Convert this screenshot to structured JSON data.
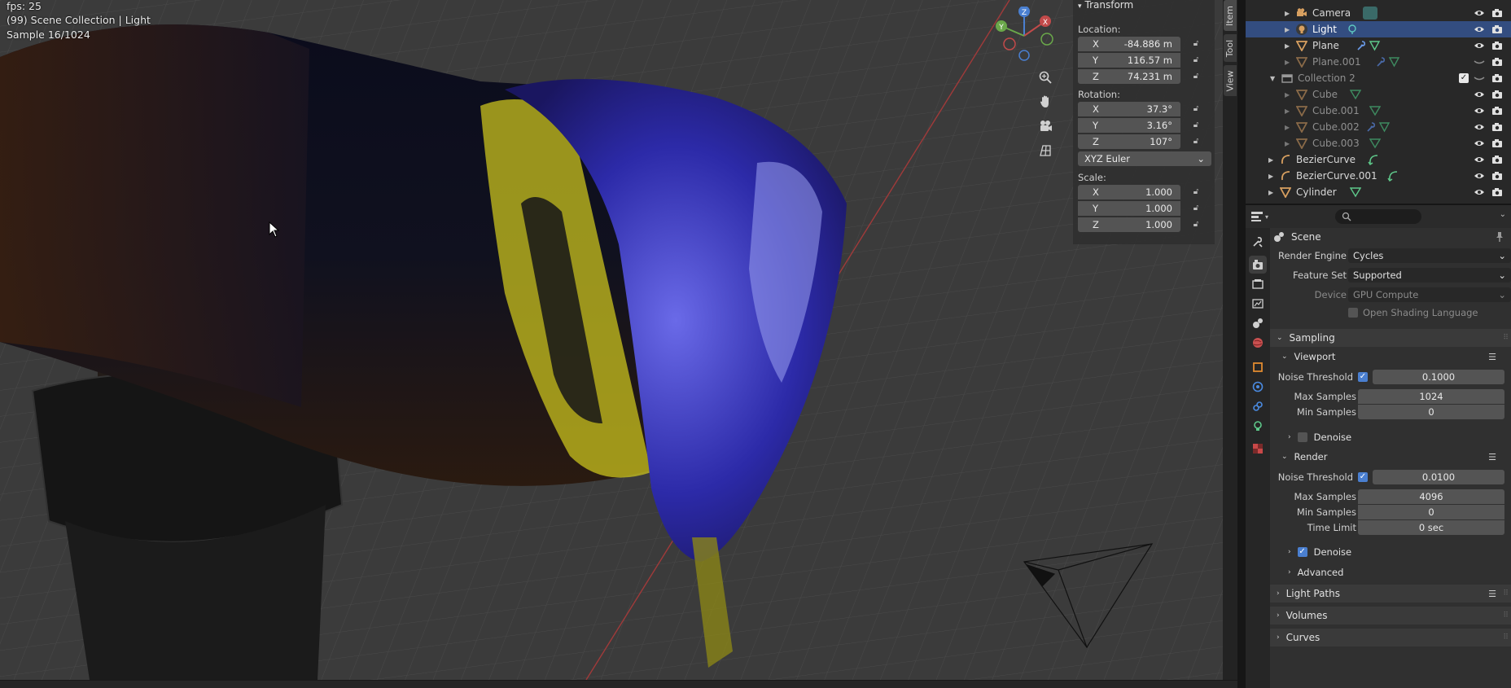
{
  "viewport": {
    "fps": "fps: 25",
    "collection": "(99) Scene Collection | Light",
    "sample": "Sample 16/1024",
    "gizmo": {
      "z": "Z",
      "y": "Y",
      "x": "X"
    }
  },
  "npanel": {
    "header": "Transform",
    "location_label": "Location:",
    "location": [
      {
        "axis": "X",
        "value": "-84.886 m"
      },
      {
        "axis": "Y",
        "value": "116.57 m"
      },
      {
        "axis": "Z",
        "value": "74.231 m"
      }
    ],
    "rotation_label": "Rotation:",
    "rotation": [
      {
        "axis": "X",
        "value": "37.3°"
      },
      {
        "axis": "Y",
        "value": "3.16°"
      },
      {
        "axis": "Z",
        "value": "107°"
      }
    ],
    "rotation_mode": "XYZ Euler",
    "scale_label": "Scale:",
    "scale": [
      {
        "axis": "X",
        "value": "1.000"
      },
      {
        "axis": "Y",
        "value": "1.000"
      },
      {
        "axis": "Z",
        "value": "1.000"
      }
    ]
  },
  "vtabs": [
    "Item",
    "Tool",
    "View"
  ],
  "outliner": {
    "items": [
      {
        "name": "Camera",
        "icon": "camera-icon"
      },
      {
        "name": "Light",
        "icon": "light-icon",
        "selected": true
      },
      {
        "name": "Plane",
        "icon": "mesh-icon"
      },
      {
        "name": "Plane.001",
        "icon": "mesh-icon",
        "dim": true
      },
      {
        "name": "Collection 2",
        "icon": "collection-icon",
        "dim": true
      },
      {
        "name": "Cube",
        "icon": "mesh-icon",
        "dim": true
      },
      {
        "name": "Cube.001",
        "icon": "mesh-icon",
        "dim": true
      },
      {
        "name": "Cube.002",
        "icon": "mesh-icon",
        "dim": true
      },
      {
        "name": "Cube.003",
        "icon": "mesh-icon",
        "dim": true
      },
      {
        "name": "BezierCurve",
        "icon": "curve-icon"
      },
      {
        "name": "BezierCurve.001",
        "icon": "curve-icon"
      },
      {
        "name": "Cylinder",
        "icon": "mesh-icon"
      }
    ]
  },
  "properties": {
    "context": "Scene",
    "render_engine_label": "Render Engine",
    "render_engine": "Cycles",
    "feature_set_label": "Feature Set",
    "feature_set": "Supported",
    "device_label": "Device",
    "device": "GPU Compute",
    "osl_label": "Open Shading Language",
    "sampling": "Sampling",
    "viewport": {
      "header": "Viewport",
      "noise_label": "Noise Threshold",
      "noise": "0.1000",
      "max_label": "Max Samples",
      "max": "1024",
      "min_label": "Min Samples",
      "min": "0"
    },
    "denoise_label": "Denoise",
    "render": {
      "header": "Render",
      "noise_label": "Noise Threshold",
      "noise": "0.0100",
      "max_label": "Max Samples",
      "max": "4096",
      "min_label": "Min Samples",
      "min": "0",
      "time_label": "Time Limit",
      "time": "0 sec"
    },
    "advanced": "Advanced",
    "light_paths": "Light Paths",
    "volumes": "Volumes",
    "curves": "Curves"
  }
}
